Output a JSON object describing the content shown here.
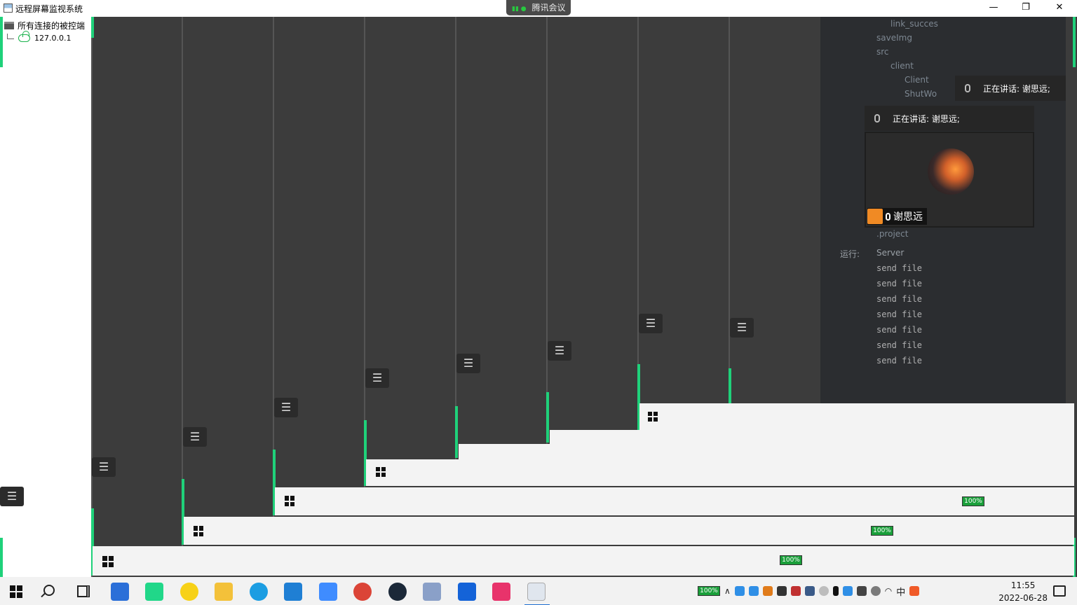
{
  "window": {
    "title": "远程屏幕监视系统",
    "minimize": "—",
    "restore": "❐",
    "close": "✕"
  },
  "meeting": {
    "app_name": "腾讯会议",
    "speaking_label": "正在讲话: 谢思远;",
    "participant_name": "谢思远"
  },
  "tree": {
    "root_label": "所有连接的被控端",
    "clients": [
      "127.0.0.1"
    ]
  },
  "ide": {
    "project_items": [
      "link_succes",
      "saveImg",
      "src",
      "client",
      "Client",
      "ShutWo",
      ".project"
    ],
    "run_label": "运行:",
    "run_tab": "Server",
    "console_lines": [
      "send file",
      "send file",
      "send file",
      "send file",
      "send file",
      "send file",
      "send file"
    ]
  },
  "taskbar": {
    "battery": "100%",
    "time": "11:55",
    "date": "2022-06-28",
    "ime": "中"
  },
  "colors": {
    "accent_green": "#1fd17a",
    "background": "#3c3c3c",
    "active_underline": "#1f6fd1"
  }
}
